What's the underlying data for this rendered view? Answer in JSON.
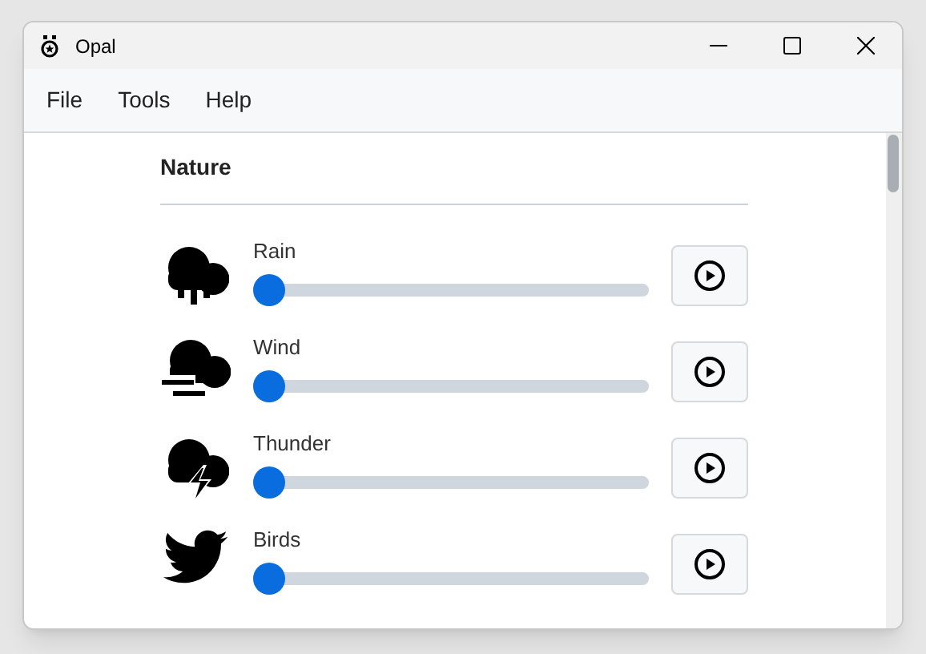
{
  "window": {
    "title": "Opal"
  },
  "menu": [
    "File",
    "Tools",
    "Help"
  ],
  "section": {
    "title": "Nature"
  },
  "sounds": [
    {
      "kind": "rain",
      "name": "Rain",
      "level": 0
    },
    {
      "kind": "wind",
      "name": "Wind",
      "level": 0
    },
    {
      "kind": "thunder",
      "name": "Thunder",
      "level": 0
    },
    {
      "kind": "birds",
      "name": "Birds",
      "level": 0
    }
  ]
}
